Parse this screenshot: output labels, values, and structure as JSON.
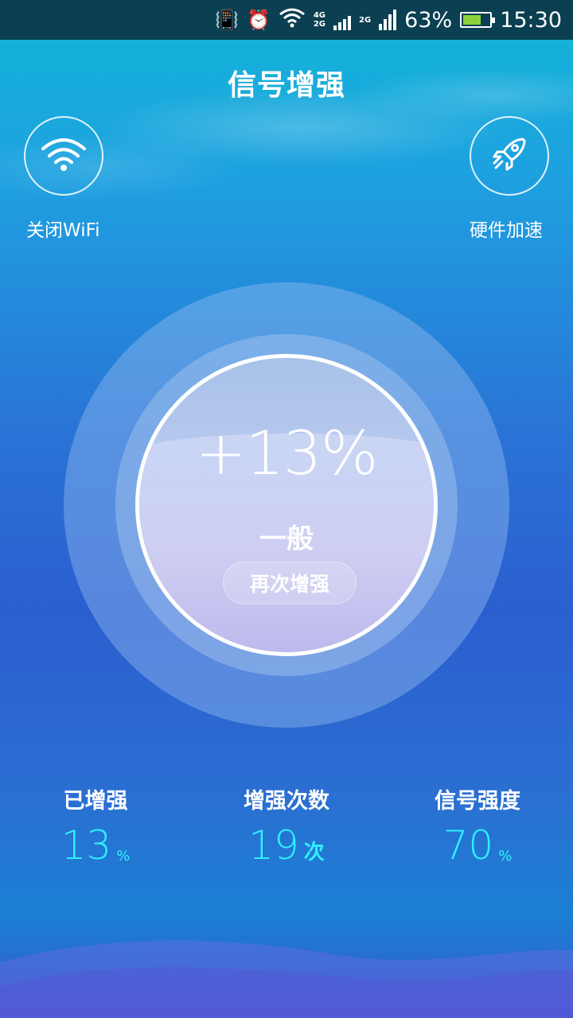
{
  "status_bar": {
    "network_primary": "4G",
    "network_secondary": "2G",
    "network_tertiary": "2G",
    "battery_percent": "63%",
    "battery_level": 0.63,
    "time": "15:30",
    "icons": [
      "vibrate-icon",
      "alarm-icon",
      "wifi-icon",
      "signal-icon",
      "battery-icon"
    ]
  },
  "header": {
    "title": "信号增强"
  },
  "actions": {
    "left": {
      "label": "关闭WiFi",
      "icon": "wifi-icon"
    },
    "right": {
      "label": "硬件加速",
      "icon": "rocket-icon"
    }
  },
  "gauge": {
    "percent": "+13%",
    "level": "一般",
    "button": "再次增强"
  },
  "stats": [
    {
      "label": "已增强",
      "value": "13",
      "unit": "%"
    },
    {
      "label": "增强次数",
      "value": "19",
      "unit": "次"
    },
    {
      "label": "信号强度",
      "value": "70",
      "unit": "%"
    }
  ],
  "colors": {
    "accent_cyan": "#2ff0ff",
    "status_bar_bg": "#0b3f52",
    "battery_fill": "#8bd13b"
  }
}
